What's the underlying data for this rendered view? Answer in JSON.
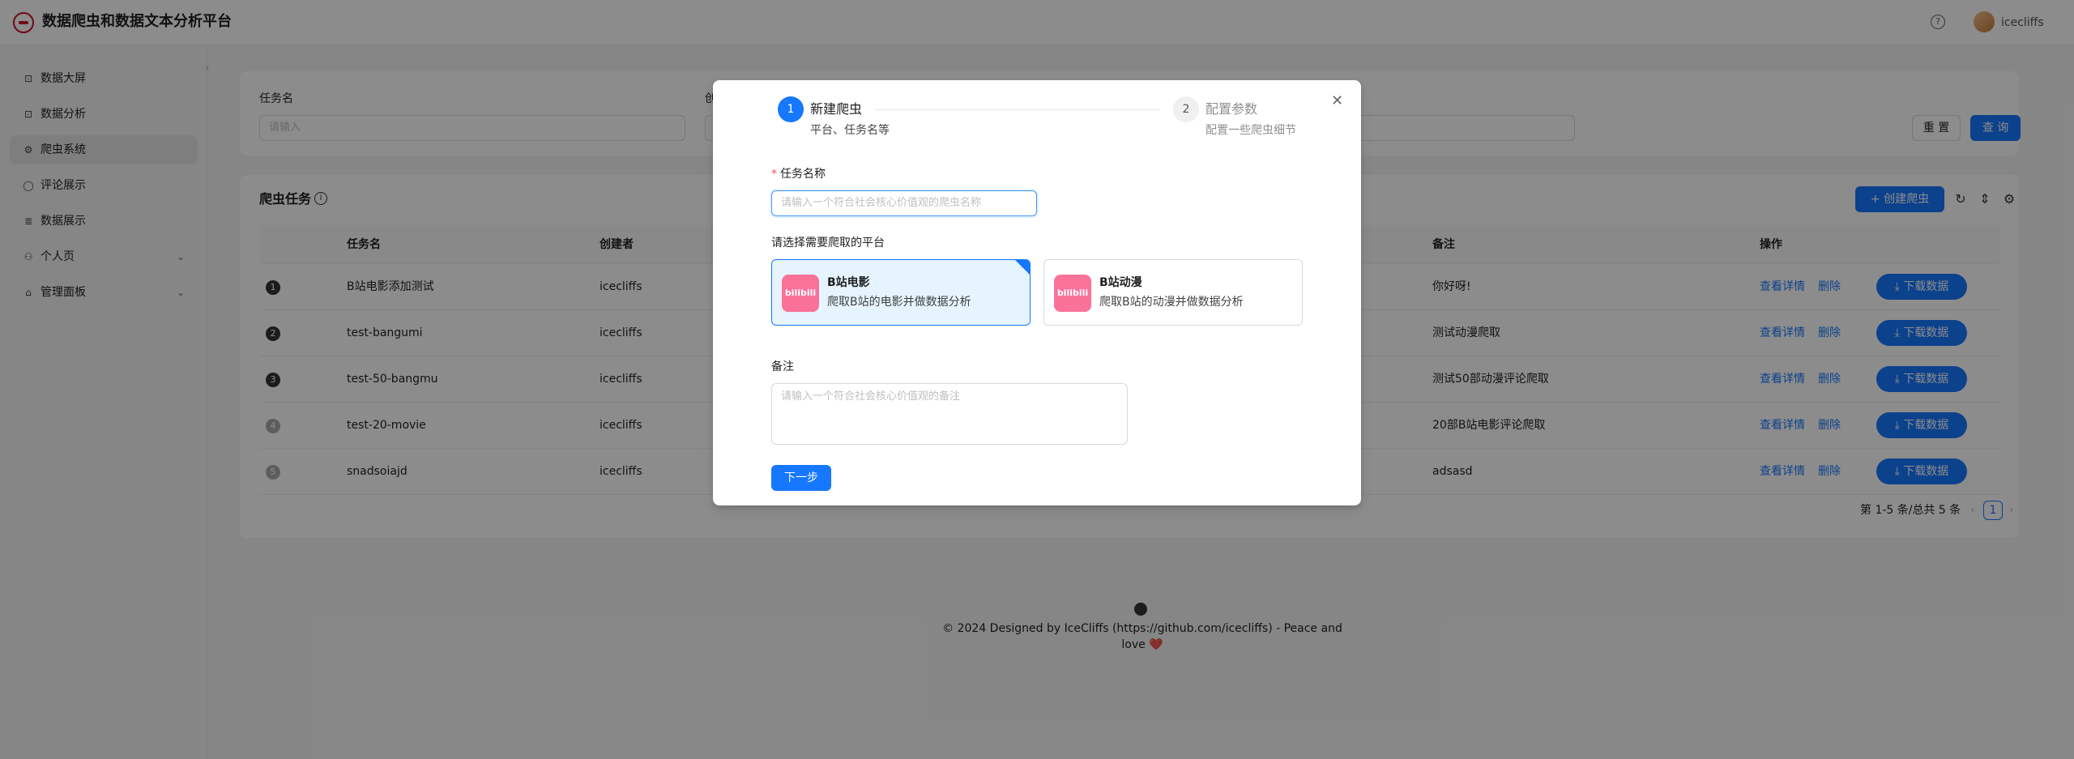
{
  "header": {
    "title": "数据爬虫和数据文本分析平台",
    "help_icon": "?",
    "user_name": "icecliffs"
  },
  "sidebar": {
    "items": [
      {
        "label": "数据大屏",
        "icon": "⊡"
      },
      {
        "label": "数据分析",
        "icon": "⊡"
      },
      {
        "label": "爬虫系统",
        "icon": "⚙"
      },
      {
        "label": "评论展示",
        "icon": "◯"
      },
      {
        "label": "数据展示",
        "icon": "≣"
      },
      {
        "label": "个人页",
        "icon": "⚇"
      },
      {
        "label": "管理面板",
        "icon": "⌂"
      }
    ],
    "collapse_icon": "‹",
    "expand_icon": "⌄"
  },
  "search": {
    "task_name_label": "任务名",
    "task_name_placeholder": "请输入",
    "creator_label_fragment": "创",
    "reset_label": "重 置",
    "query_label": "查 询"
  },
  "table": {
    "title": "爬虫任务",
    "create_label": "+ 创建爬虫",
    "columns": [
      "任务名",
      "创建者",
      "备注",
      "操作"
    ],
    "rows": [
      {
        "index": "1",
        "name": "B站电影添加测试",
        "creator": "icecliffs",
        "remark": "你好呀!"
      },
      {
        "index": "2",
        "name": "test-bangumi",
        "creator": "icecliffs",
        "remark": "测试动漫爬取"
      },
      {
        "index": "3",
        "name": "test-50-bangmu",
        "creator": "icecliffs",
        "remark": "测试50部动漫评论爬取"
      },
      {
        "index": "4",
        "name": "test-20-movie",
        "creator": "icecliffs",
        "remark": "20部B站电影评论爬取"
      },
      {
        "index": "5",
        "name": "snadsoiajd",
        "creator": "icecliffs",
        "remark": "adsasd"
      }
    ],
    "actions": {
      "view": "查看详情",
      "delete": "删除",
      "download": "⤓ 下载数据"
    },
    "pagination": {
      "summary": "第 1-5 条/总共 5 条",
      "current_page": "1",
      "prev": "‹",
      "next": "›"
    }
  },
  "footer": {
    "text": "© 2024 Designed by IceCliffs (https://github.com/icecliffs) - Peace and love ❤️"
  },
  "modal": {
    "close_icon": "✕",
    "steps": [
      {
        "number": "1",
        "title": "新建爬虫",
        "description": "平台、任务名等"
      },
      {
        "number": "2",
        "title": "配置参数",
        "description": "配置一些爬虫细节"
      }
    ],
    "task_name_required": "*",
    "task_name_label": "任务名称",
    "task_name_placeholder": "请输入一个符合社会核心价值观的爬虫名称",
    "platform_label": "请选择需要爬取的平台",
    "platforms": [
      {
        "title": "B站电影",
        "description": "爬取B站的电影并做数据分析",
        "icon_text": "bilibili",
        "selected": true
      },
      {
        "title": "B站动漫",
        "description": "爬取B站的动漫并做数据分析",
        "icon_text": "bilibili",
        "selected": false
      }
    ],
    "remark_label": "备注",
    "remark_placeholder": "请输入一个符合社会核心价值观的备注",
    "next_label": "下一步"
  },
  "colors": {
    "primary": "#1677ff",
    "bilibili_pink": "#fb7299",
    "danger": "#ff4d4f"
  }
}
